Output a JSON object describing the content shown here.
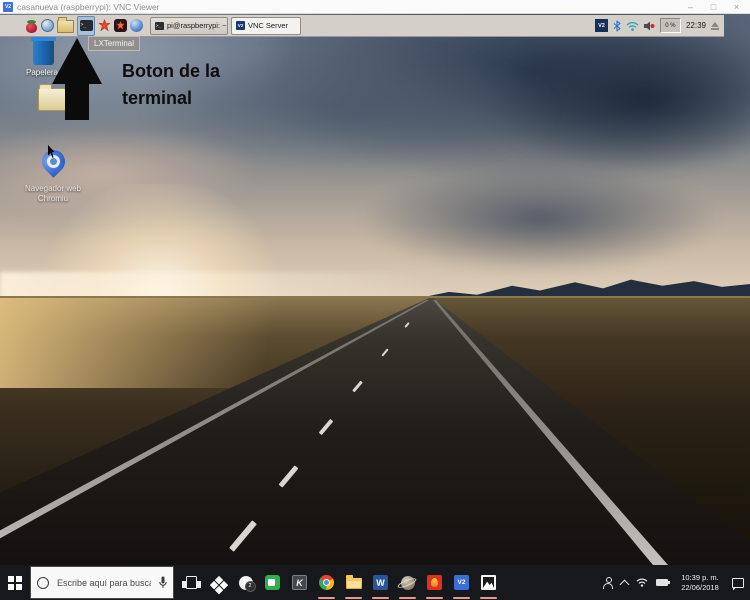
{
  "vnc_viewer": {
    "logo": "V2",
    "title": "casanueva (raspberrypi): VNC Viewer",
    "minimize": "–",
    "maximize": "□",
    "close": "×"
  },
  "pi_taskbar": {
    "tooltip": "LXTerminal",
    "window_buttons": [
      {
        "label": "pi@raspberrypi: ~"
      },
      {
        "label": "VNC Server",
        "logo": "V2"
      }
    ],
    "tray": {
      "vnc_logo": "V2",
      "cpu": "0 %",
      "clock": "22:39"
    }
  },
  "desktop": {
    "annotation": "Boton de la terminal",
    "icons": {
      "trash_label": "Papelera",
      "browser_label": "Navegador web Chromiu"
    }
  },
  "win_taskbar": {
    "search_placeholder": "Escribe aquí para buscar",
    "xbox_badge": "2",
    "icon_glyphs": {
      "word": "W",
      "k_app": "K",
      "vnc": "V2"
    },
    "clock_time": "10:39 p. m.",
    "clock_date": "22/06/2018"
  },
  "colors": {
    "open_indicator": "#e89a8a",
    "win_taskbar_bg": "#17181c",
    "pi_taskbar_bg": "#d4d0c9",
    "vnc_blue": "#3a6fd8"
  }
}
